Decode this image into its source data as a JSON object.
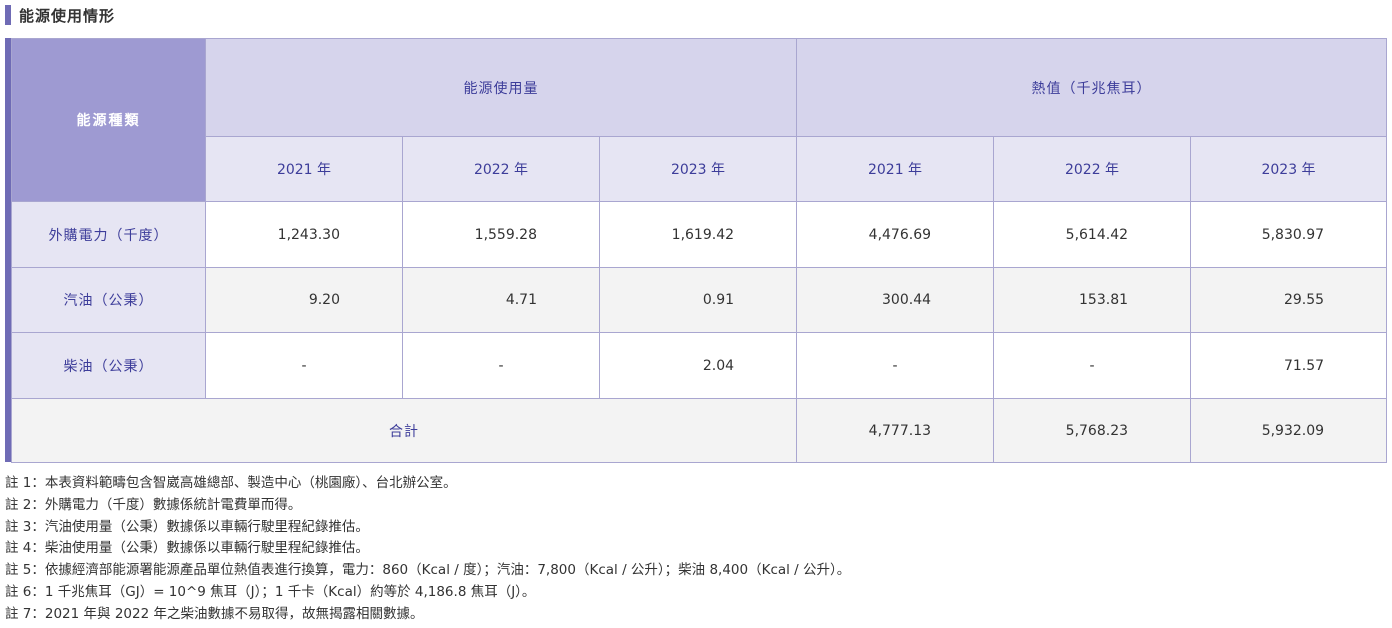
{
  "section_title": "能源使用情形",
  "table": {
    "corner_header": "能源種類",
    "group_headers": [
      "能源使用量",
      "熱值（千兆焦耳）"
    ],
    "years": [
      "2021 年",
      "2022 年",
      "2023 年",
      "2021 年",
      "2022 年",
      "2023 年"
    ],
    "rows": [
      {
        "label": "外購電力（千度）",
        "values": [
          "1,243.30",
          "1,559.28",
          "1,619.42",
          "4,476.69",
          "5,614.42",
          "5,830.97"
        ]
      },
      {
        "label": "汽油（公秉）",
        "values": [
          "9.20",
          "4.71",
          "0.91",
          "300.44",
          "153.81",
          "29.55"
        ]
      },
      {
        "label": "柴油（公秉）",
        "values": [
          "-",
          "-",
          "2.04",
          "-",
          "-",
          "71.57"
        ]
      }
    ],
    "total": {
      "label": "合計",
      "values": [
        "4,777.13",
        "5,768.23",
        "5,932.09"
      ]
    }
  },
  "notes": [
    "註 1：本表資料範疇包含智崴高雄總部、製造中心（桃園廠）、台北辦公室。",
    "註 2：外購電力（千度）數據係統計電費單而得。",
    "註 3：汽油使用量（公秉）數據係以車輛行駛里程紀錄推估。",
    "註 4：柴油使用量（公秉）數據係以車輛行駛里程紀錄推估。",
    "註 5：依據經濟部能源署能源產品單位熱值表進行換算，電力：860（Kcal / 度）；汽油：7,800（Kcal / 公升）；柴油 8,400（Kcal / 公升）。",
    "註 6：1 千兆焦耳（GJ）= 10^9 焦耳（J）；1 千卡（Kcal）約等於 4,186.8 焦耳（J）。",
    "註 7：2021 年與 2022 年之柴油數據不易取得，故無揭露相關數據。"
  ]
}
